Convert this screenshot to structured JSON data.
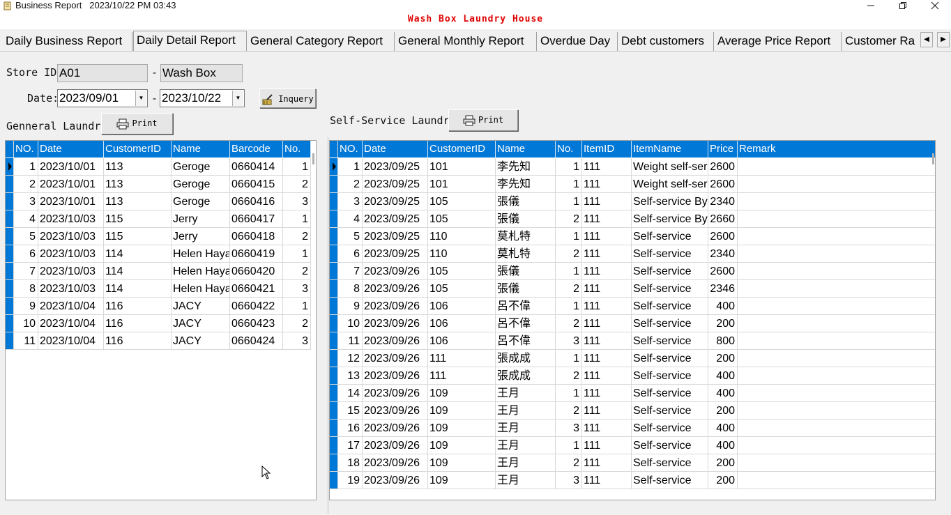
{
  "window": {
    "title": "Business Report   2023/10/22 PM 03:43",
    "app_icon": "report-book-icon",
    "buttons": {
      "minimize": "minimize-icon",
      "maximize": "restore-icon",
      "close": "close-icon"
    }
  },
  "header": {
    "text": "Wash Box Laundry House",
    "color": "#e00000"
  },
  "tabs": [
    {
      "label": "Daily Business Report",
      "active": false
    },
    {
      "label": "Daily Detail Report",
      "active": true
    },
    {
      "label": "General Category Report",
      "active": false
    },
    {
      "label": "General Monthly Report",
      "active": false
    },
    {
      "label": "Overdue Day",
      "active": false
    },
    {
      "label": "Debt customers",
      "active": false
    },
    {
      "label": "Average Price Report",
      "active": false
    },
    {
      "label": "Customer Ra",
      "active": false
    }
  ],
  "form": {
    "store_label": "Store ID:",
    "store_id": "A01",
    "separator": "-",
    "store_name": "Wash Box",
    "date_label": "Date:",
    "date_from": "2023/09/01",
    "date_to": "2023/10/22",
    "inquery_label": "Inquery"
  },
  "general": {
    "title": "Genneral Laundry",
    "print_label": "Print",
    "columns": [
      "NO.",
      "Date",
      "CustomerID",
      "Name",
      "Barcode",
      "No."
    ],
    "rows": [
      [
        "1",
        "2023/10/01",
        "113",
        "Geroge",
        "0660414",
        "1"
      ],
      [
        "2",
        "2023/10/01",
        "113",
        "Geroge",
        "0660415",
        "2"
      ],
      [
        "3",
        "2023/10/01",
        "113",
        "Geroge",
        "0660416",
        "3"
      ],
      [
        "4",
        "2023/10/03",
        "115",
        "Jerry",
        "0660417",
        "1"
      ],
      [
        "5",
        "2023/10/03",
        "115",
        "Jerry",
        "0660418",
        "2"
      ],
      [
        "6",
        "2023/10/03",
        "114",
        "Helen Haya",
        "0660419",
        "1"
      ],
      [
        "7",
        "2023/10/03",
        "114",
        "Helen Haya",
        "0660420",
        "2"
      ],
      [
        "8",
        "2023/10/03",
        "114",
        "Helen Haya",
        "0660421",
        "3"
      ],
      [
        "9",
        "2023/10/04",
        "116",
        "JACY",
        "0660422",
        "1"
      ],
      [
        "10",
        "2023/10/04",
        "116",
        "JACY",
        "0660423",
        "2"
      ],
      [
        "11",
        "2023/10/04",
        "116",
        "JACY",
        "0660424",
        "3"
      ]
    ]
  },
  "self": {
    "title": "Self-Service Laundry",
    "print_label": "Print",
    "columns": [
      "NO.",
      "Date",
      "CustomerID",
      "Name",
      "No.",
      "ItemID",
      "ItemName",
      "Price",
      "Remark"
    ],
    "rows": [
      [
        "1",
        "2023/09/25",
        "101",
        "李先知",
        "1",
        "111",
        "Weight self-ser",
        "2600",
        ""
      ],
      [
        "2",
        "2023/09/25",
        "101",
        "李先知",
        "1",
        "111",
        "Weight self-ser",
        "2600",
        ""
      ],
      [
        "3",
        "2023/09/25",
        "105",
        "張儀",
        "1",
        "111",
        "Self-service By",
        "2340",
        ""
      ],
      [
        "4",
        "2023/09/25",
        "105",
        "張儀",
        "2",
        "111",
        "Self-service By",
        "2660",
        ""
      ],
      [
        "5",
        "2023/09/25",
        "110",
        "莫札特",
        "1",
        "111",
        "Self-service",
        "2600",
        ""
      ],
      [
        "6",
        "2023/09/25",
        "110",
        "莫札特",
        "2",
        "111",
        "Self-service",
        "2340",
        ""
      ],
      [
        "7",
        "2023/09/26",
        "105",
        "張儀",
        "1",
        "111",
        "Self-service",
        "2600",
        ""
      ],
      [
        "8",
        "2023/09/26",
        "105",
        "張儀",
        "2",
        "111",
        "Self-service",
        "2346",
        ""
      ],
      [
        "9",
        "2023/09/26",
        "106",
        "呂不偉",
        "1",
        "111",
        "Self-service",
        "400",
        ""
      ],
      [
        "10",
        "2023/09/26",
        "106",
        "呂不偉",
        "2",
        "111",
        "Self-service",
        "200",
        ""
      ],
      [
        "11",
        "2023/09/26",
        "106",
        "呂不偉",
        "3",
        "111",
        "Self-service",
        "800",
        ""
      ],
      [
        "12",
        "2023/09/26",
        "111",
        "張成成",
        "1",
        "111",
        "Self-service",
        "200",
        ""
      ],
      [
        "13",
        "2023/09/26",
        "111",
        "張成成",
        "2",
        "111",
        "Self-service",
        "400",
        ""
      ],
      [
        "14",
        "2023/09/26",
        "109",
        "王月",
        "1",
        "111",
        "Self-service",
        "400",
        ""
      ],
      [
        "15",
        "2023/09/26",
        "109",
        "王月",
        "2",
        "111",
        "Self-service",
        "200",
        ""
      ],
      [
        "16",
        "2023/09/26",
        "109",
        "王月",
        "3",
        "111",
        "Self-service",
        "400",
        ""
      ],
      [
        "17",
        "2023/09/26",
        "109",
        "王月",
        "1",
        "111",
        "Self-service",
        "400",
        ""
      ],
      [
        "18",
        "2023/09/26",
        "109",
        "王月",
        "2",
        "111",
        "Self-service",
        "200",
        ""
      ],
      [
        "19",
        "2023/09/26",
        "109",
        "王月",
        "3",
        "111",
        "Self-service",
        "200",
        ""
      ]
    ]
  }
}
